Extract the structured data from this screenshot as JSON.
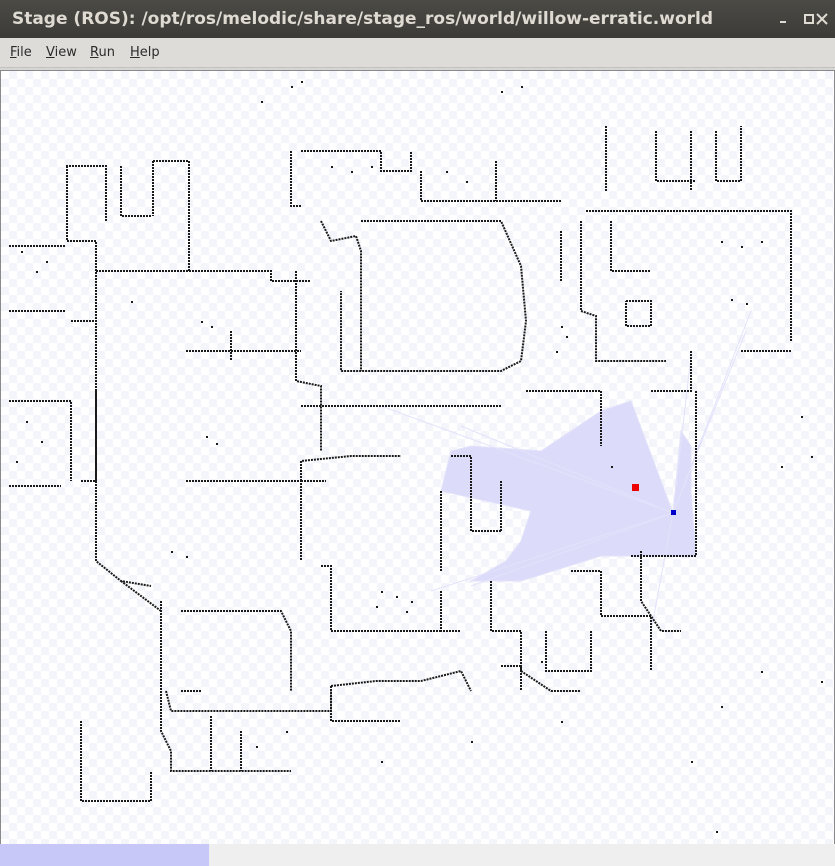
{
  "window": {
    "title": "Stage (ROS): /opt/ros/melodic/share/stage_ros/world/willow-erratic.world",
    "minimize_glyph": "▫",
    "maximize_glyph": "▪",
    "close_glyph": "✕"
  },
  "menubar": {
    "items": [
      {
        "label": "File",
        "underline": "F",
        "rest": "ile"
      },
      {
        "label": "View",
        "underline": "V",
        "rest": "iew"
      },
      {
        "label": "Run",
        "underline": "R",
        "rest": "un"
      },
      {
        "label": "Help",
        "underline": "H",
        "rest": "elp"
      }
    ]
  },
  "world": {
    "map_color": "#1a1a1a",
    "laser_color": "#dcdcfa",
    "robot_color": "#0000cc",
    "block_color": "#ee0000"
  },
  "status": {
    "progress_fraction": 0.25
  }
}
